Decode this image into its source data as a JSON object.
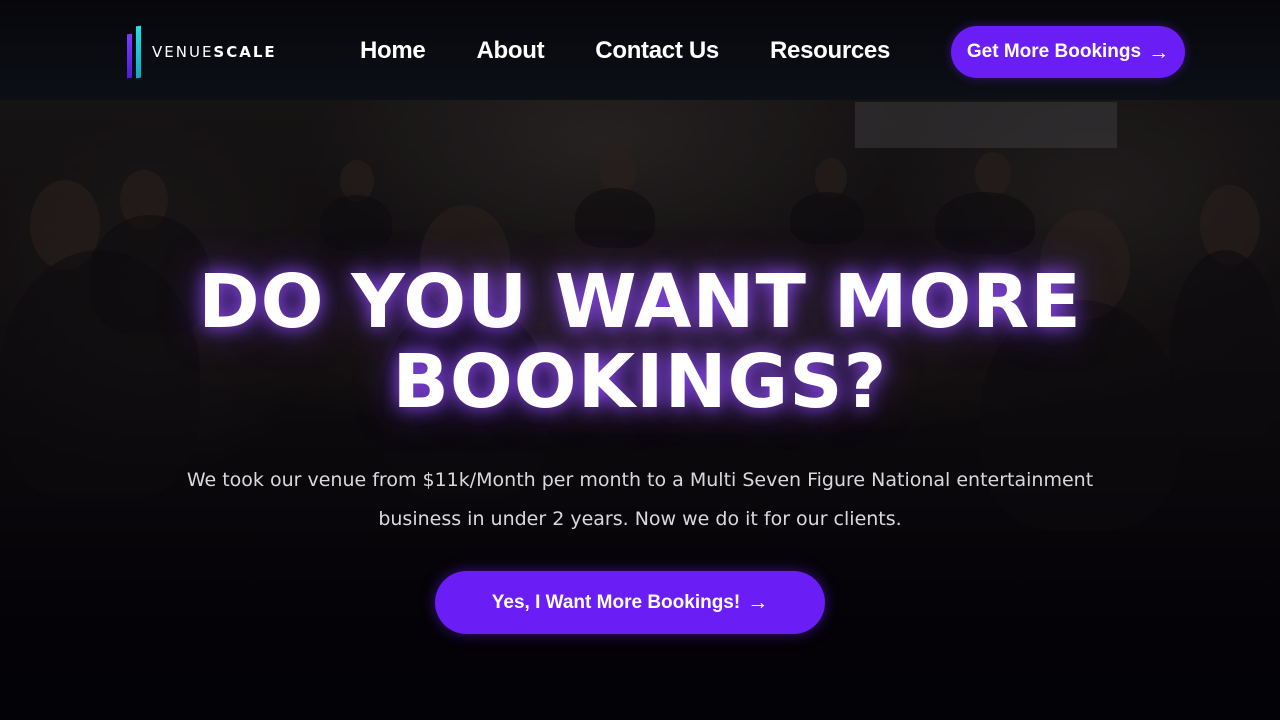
{
  "brand": {
    "logo_text_part1": "VENUE",
    "logo_text_part2": "SCALE",
    "logo_icon": "venuescale-logo-icon",
    "accent_color": "#6a1df5",
    "logo_colors": [
      "#7b3bff",
      "#22e0e8"
    ]
  },
  "nav": {
    "items": [
      {
        "label": "Home"
      },
      {
        "label": "About"
      },
      {
        "label": "Contact Us"
      },
      {
        "label": "Resources"
      }
    ],
    "cta_label": "Get More Bookings",
    "cta_icon": "arrow-right-icon"
  },
  "hero": {
    "headline_line1": "DO YOU WANT MORE",
    "headline_line2": "BOOKINGS?",
    "subtext_line1": "We took our venue from $11k/Month per month to a Multi Seven Figure National entertainment",
    "subtext_line2": "business in under 2 years. Now we do it for our clients.",
    "cta_label": "Yes, I Want More Bookings!",
    "cta_icon": "arrow-right-icon"
  }
}
